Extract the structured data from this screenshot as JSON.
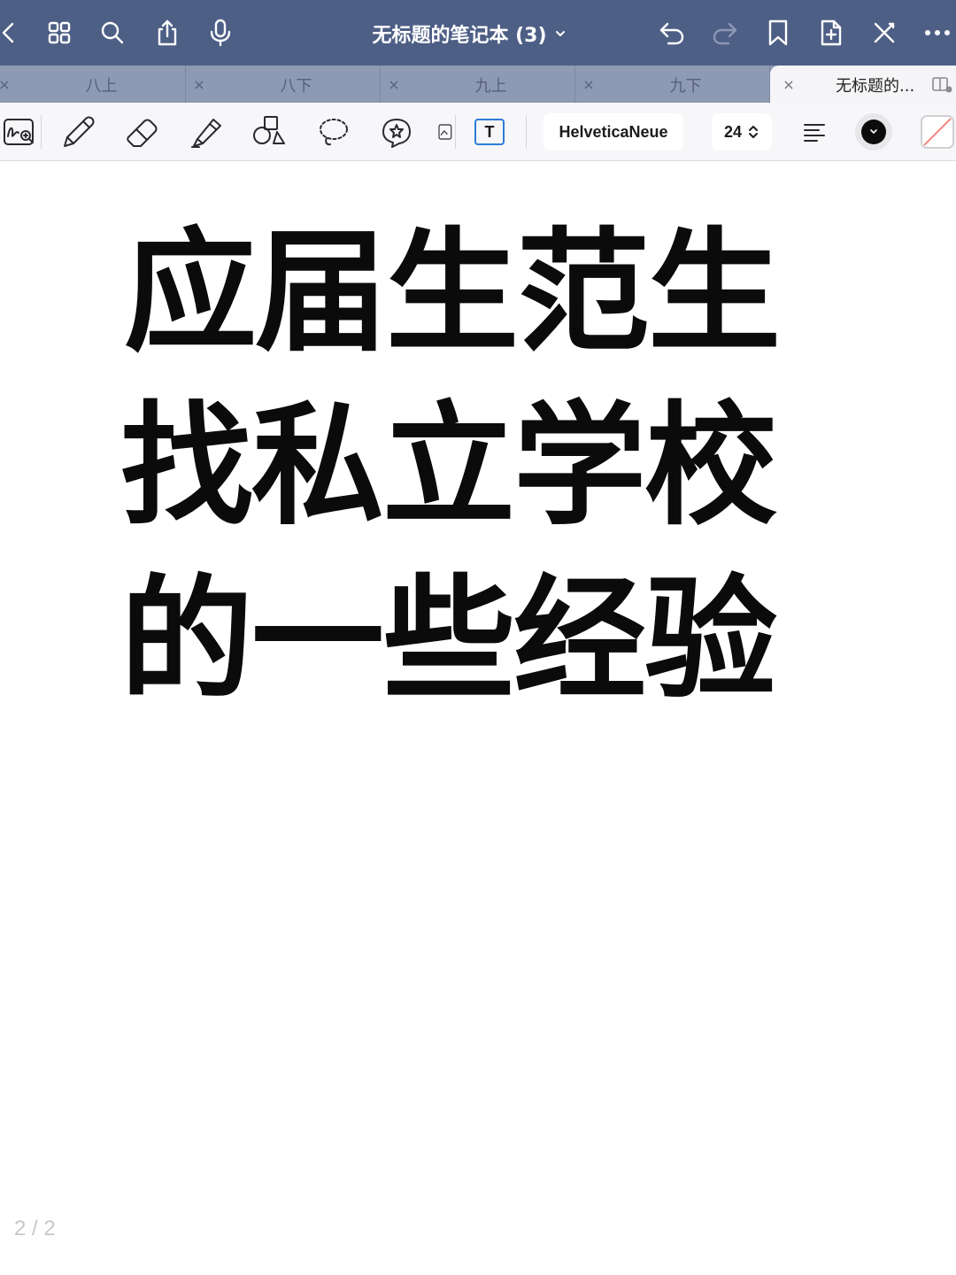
{
  "topbar": {
    "title": "无标题的笔记本 (3)",
    "icons": [
      "back-icon",
      "grid-icon",
      "search-icon",
      "share-icon",
      "mic-icon",
      "undo-icon",
      "redo-icon",
      "bookmark-icon",
      "add-page-icon",
      "close-pen-icon",
      "more-icon"
    ],
    "bg_color": "#4e5f86"
  },
  "tabs": [
    {
      "label": "八上",
      "close": "×"
    },
    {
      "label": "八下",
      "close": "×"
    },
    {
      "label": "九上",
      "close": "×"
    },
    {
      "label": "九下",
      "close": "×"
    },
    {
      "label": "无标题的...",
      "close": "×",
      "active": true
    }
  ],
  "toolbar": {
    "tools": [
      "handwriting-search-icon",
      "pen-icon",
      "eraser-icon",
      "highlighter-icon",
      "shapes-icon",
      "lasso-icon",
      "sticker-icon",
      "image-icon",
      "text-tool-icon"
    ],
    "text_tool_glyph": "T",
    "font_name": "HelveticaNeue",
    "font_size": "24",
    "text_color": "#0c0c0c"
  },
  "canvas": {
    "lines": [
      "应届生范生",
      "找私立学校",
      "的一些经验"
    ],
    "page_indicator": "2 / 2"
  }
}
